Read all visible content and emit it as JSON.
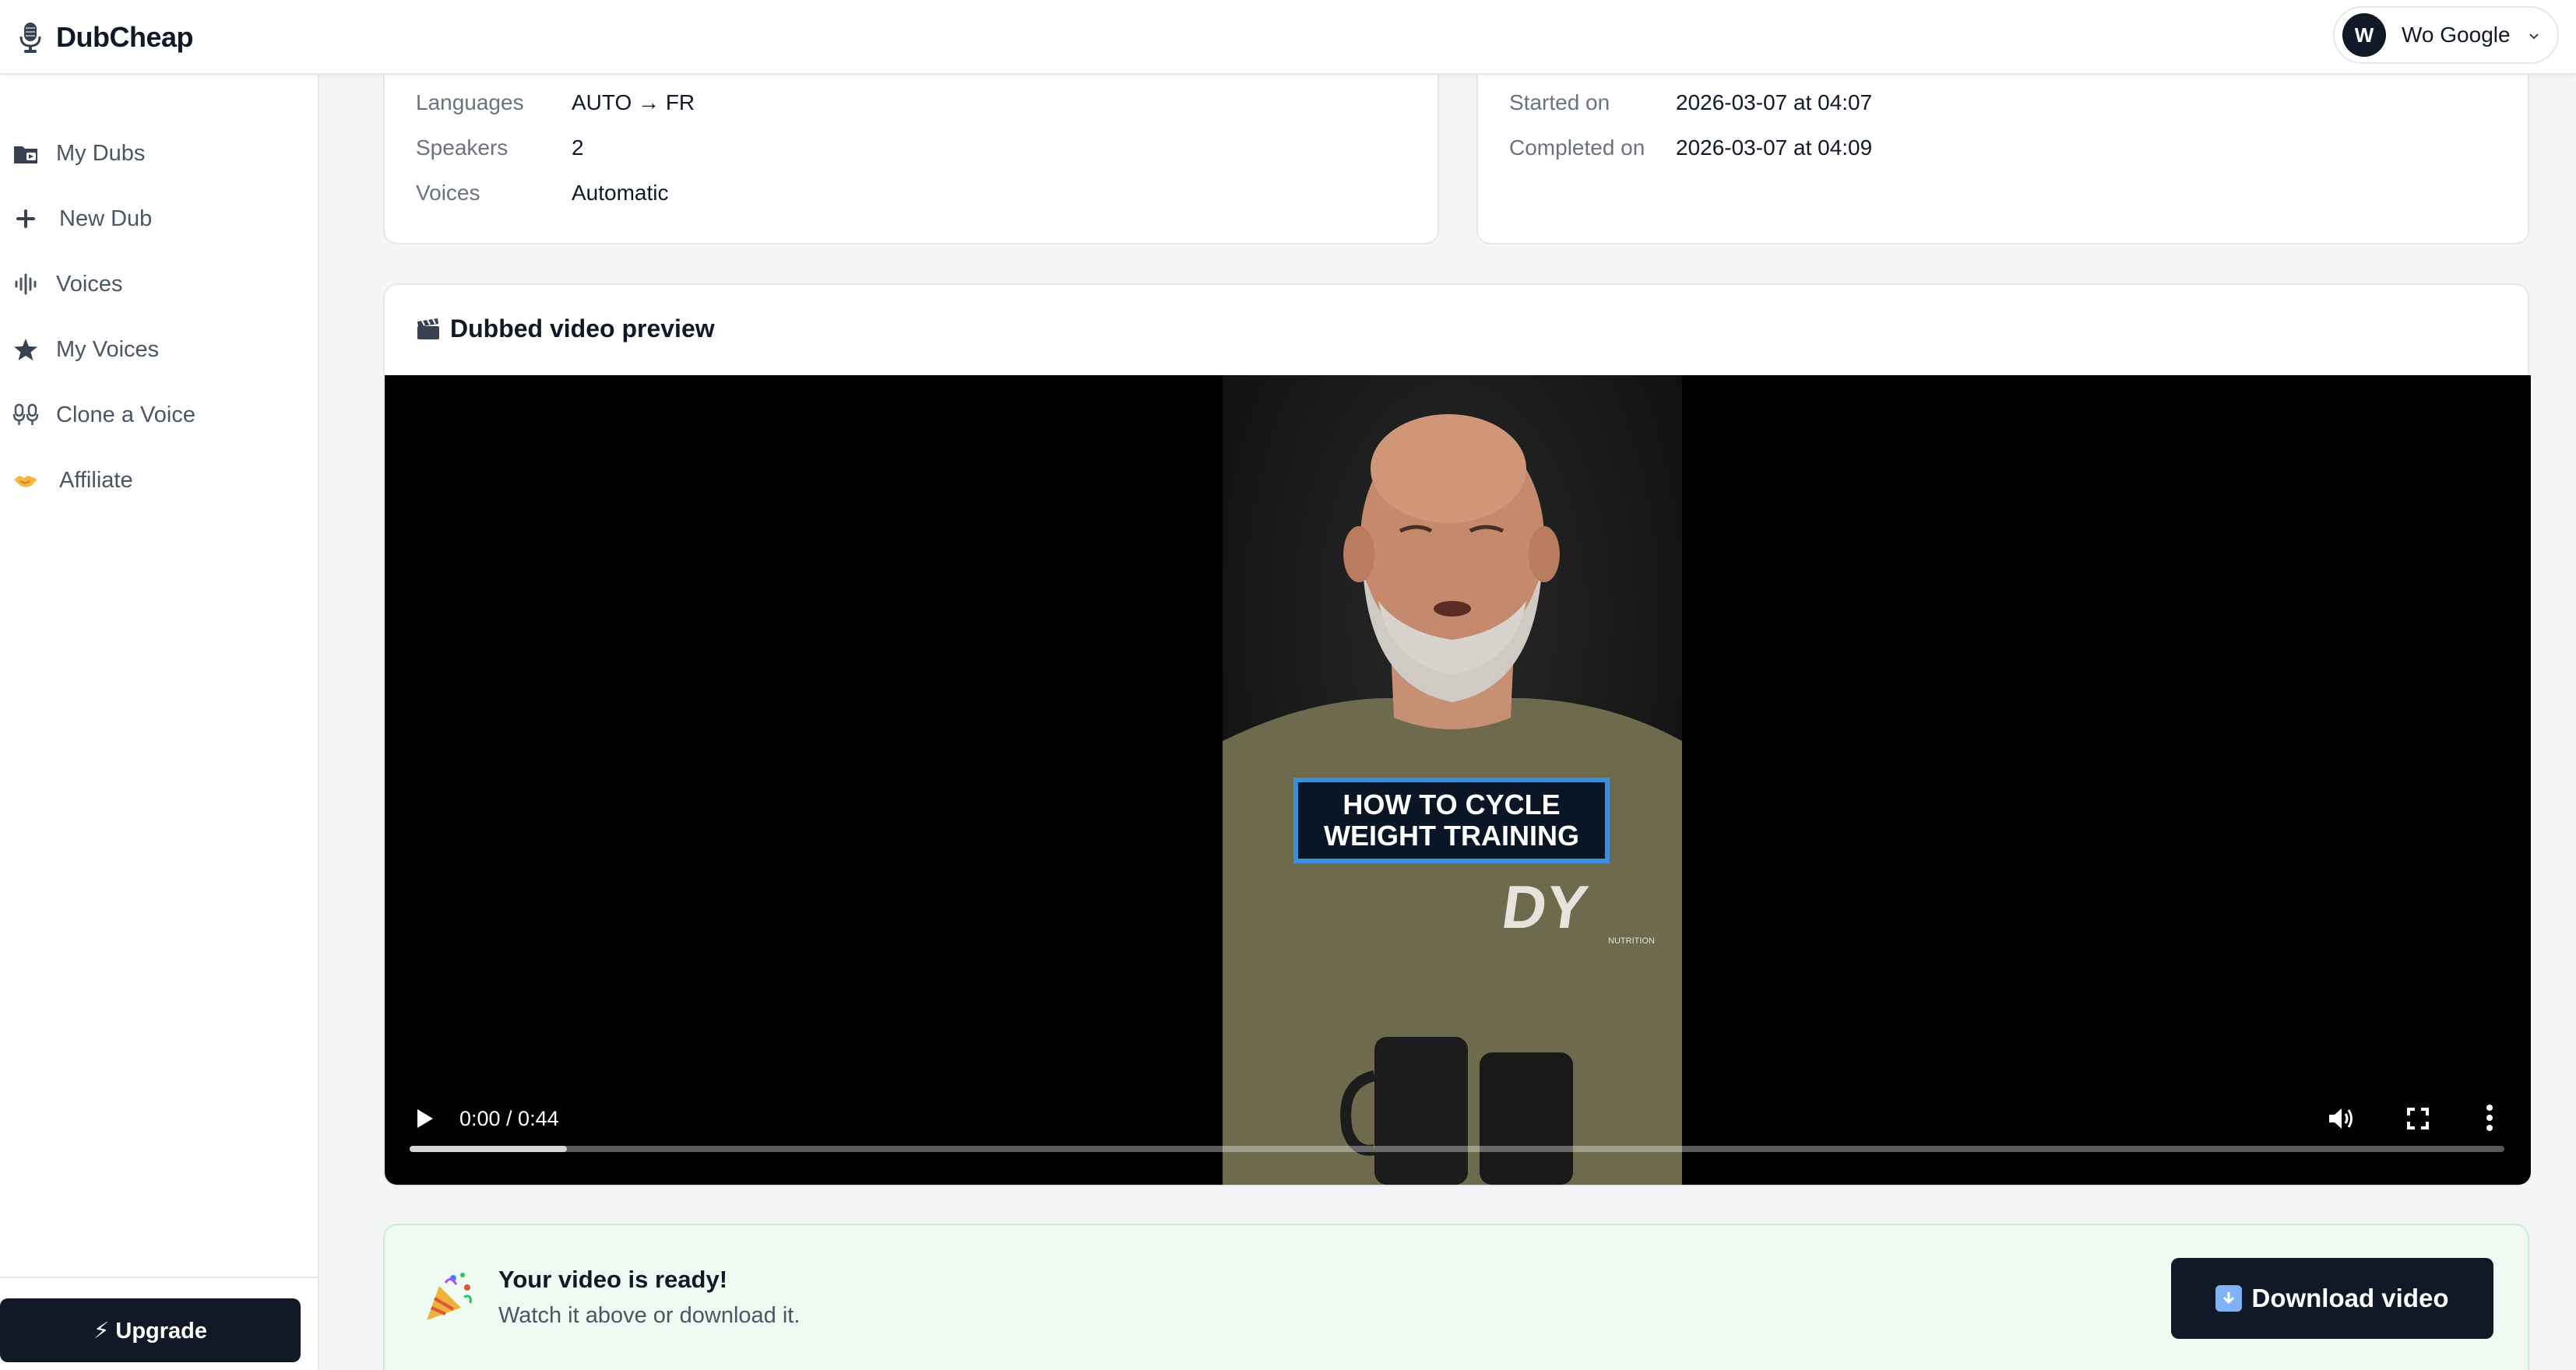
{
  "app": {
    "name": "DubCheap"
  },
  "account": {
    "initial": "W",
    "name": "Wo Google"
  },
  "sidebar": {
    "items": [
      {
        "label": "My Dubs",
        "icon": "folder-icon"
      },
      {
        "label": "New Dub",
        "icon": "plus-icon"
      },
      {
        "label": "Voices",
        "icon": "waveform-icon"
      },
      {
        "label": "My Voices",
        "icon": "star-icon"
      },
      {
        "label": "Clone a Voice",
        "icon": "clone-icon"
      },
      {
        "label": "Affiliate",
        "icon": "handshake-icon"
      }
    ],
    "upgrade_label": "⚡ Upgrade"
  },
  "details_left": {
    "rows": [
      {
        "key": "Languages",
        "value": "AUTO → FR"
      },
      {
        "key": "Speakers",
        "value": "2"
      },
      {
        "key": "Voices",
        "value": "Automatic"
      }
    ]
  },
  "details_right": {
    "rows": [
      {
        "key": "Started on",
        "value": "2026-03-07 at 04:07"
      },
      {
        "key": "Completed on",
        "value": "2026-03-07 at 04:09"
      }
    ]
  },
  "preview": {
    "title": "Dubbed video preview",
    "title_icon": "clapperboard-icon",
    "caption_line1": "HOW TO CYCLE",
    "caption_line2": "WEIGHT TRAINING",
    "shirt_logo": "DY",
    "shirt_logo_sub": "NUTRITION",
    "time": "0:00 / 0:44",
    "buffered_fraction": 0.075
  },
  "ready": {
    "title": "Your video is ready!",
    "subtitle": "Watch it above or download it.",
    "download_label": "Download video"
  },
  "colors": {
    "primary_dark": "#111827",
    "success_bg": "#eefaf2",
    "caption_border": "#3b8fd9"
  }
}
